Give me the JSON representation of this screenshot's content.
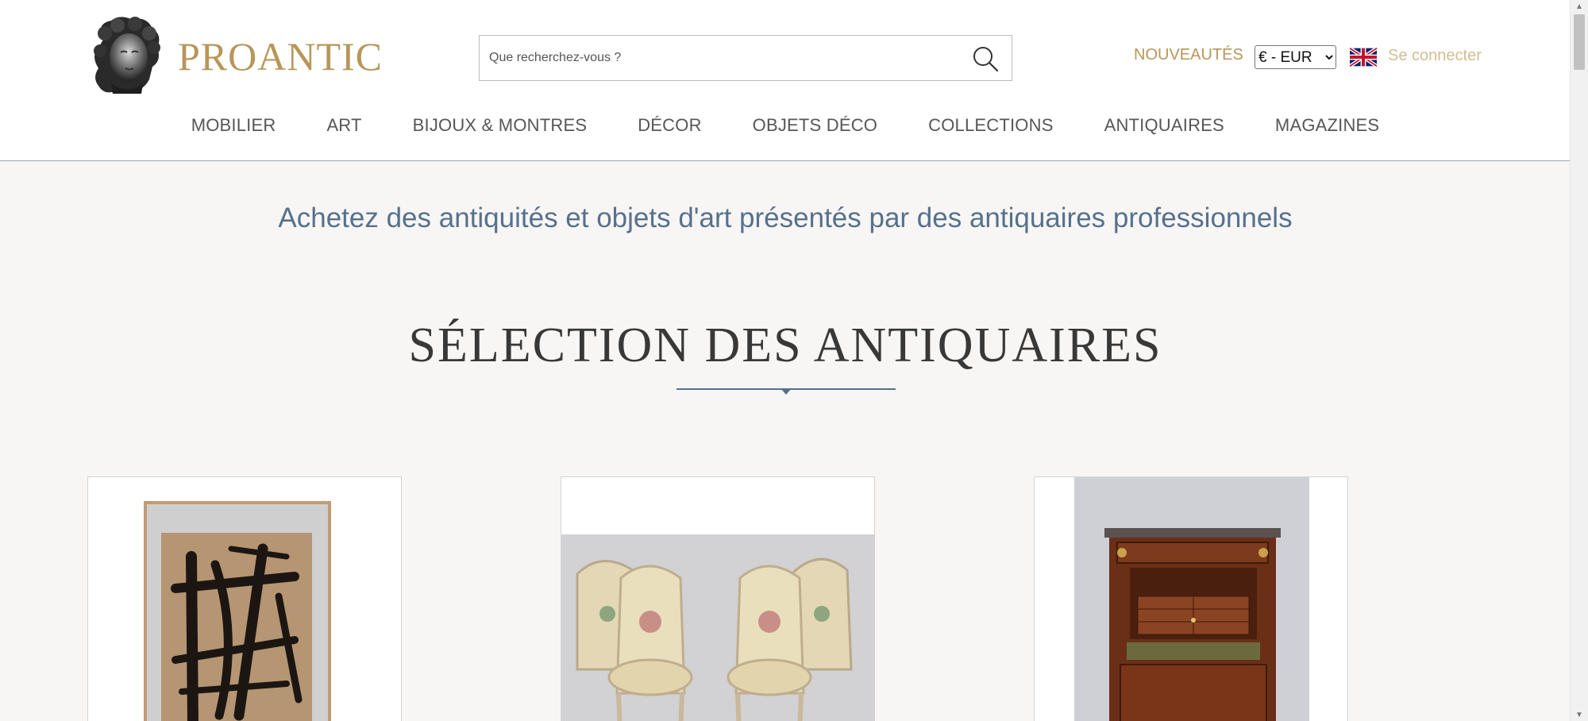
{
  "brand": {
    "name": "PROANTIC"
  },
  "search": {
    "placeholder": "Que recherchez-vous ?"
  },
  "header_links": {
    "new": "NOUVEAUTÉS",
    "currency_selected": "€ - EUR",
    "language_flag": "uk-flag-icon",
    "login": "Se connecter"
  },
  "nav": [
    {
      "label": "MOBILIER"
    },
    {
      "label": "ART"
    },
    {
      "label": "BIJOUX & MONTRES"
    },
    {
      "label": "DÉCOR"
    },
    {
      "label": "OBJETS DÉCO"
    },
    {
      "label": "COLLECTIONS"
    },
    {
      "label": "ANTIQUAIRES"
    },
    {
      "label": "MAGAZINES"
    }
  ],
  "tagline": "Achetez des antiquités et objets d'art présentés par des antiquaires professionnels",
  "section": {
    "title": "SÉLECTION DES ANTIQUAIRES"
  },
  "cards": [
    {
      "image": "abstract-ink-painting-image"
    },
    {
      "image": "four-armchairs-image"
    },
    {
      "image": "secretary-desk-image"
    }
  ],
  "colors": {
    "gold": "#b8965a",
    "light_gold": "#d4bd92",
    "slate_blue": "#56718c",
    "background": "#f7f6f5"
  }
}
